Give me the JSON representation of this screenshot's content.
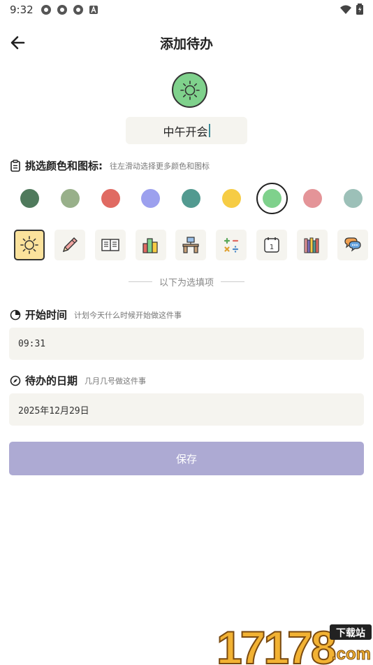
{
  "status": {
    "time": "9:32"
  },
  "header": {
    "title": "添加待办"
  },
  "task_name": {
    "value": "中午开会"
  },
  "color_section": {
    "label": "挑选颜色和图标:",
    "hint": "往左滑动选择更多颜色和图标",
    "selected_color": "#7fd18c",
    "colors": [
      "#4f7a5c",
      "#98b08a",
      "#e06a62",
      "#9ca0ee",
      "#529a90",
      "#f6cc44",
      "#7fd18c",
      "#e49498",
      "#9cc0b8"
    ]
  },
  "icon_options": [
    "sun-icon",
    "pencil-icon",
    "book-icon",
    "books-stack-icon",
    "desk-icon",
    "calculator-icon",
    "calendar-icon",
    "bookshelf-icon",
    "chat-bubbles-icon"
  ],
  "calendar_icon_number": "1",
  "optional_divider": "以下为选填项",
  "start_time": {
    "label": "开始时间",
    "hint": "计划今天什么时候开始做这件事",
    "value": "09:31"
  },
  "due_date": {
    "label": "待办的日期",
    "hint": "几月几号做这件事",
    "value": "2025年12月29日"
  },
  "save_label": "保存",
  "watermark": {
    "digits": "17178",
    "badge": "下载站",
    "domain": ".com"
  }
}
